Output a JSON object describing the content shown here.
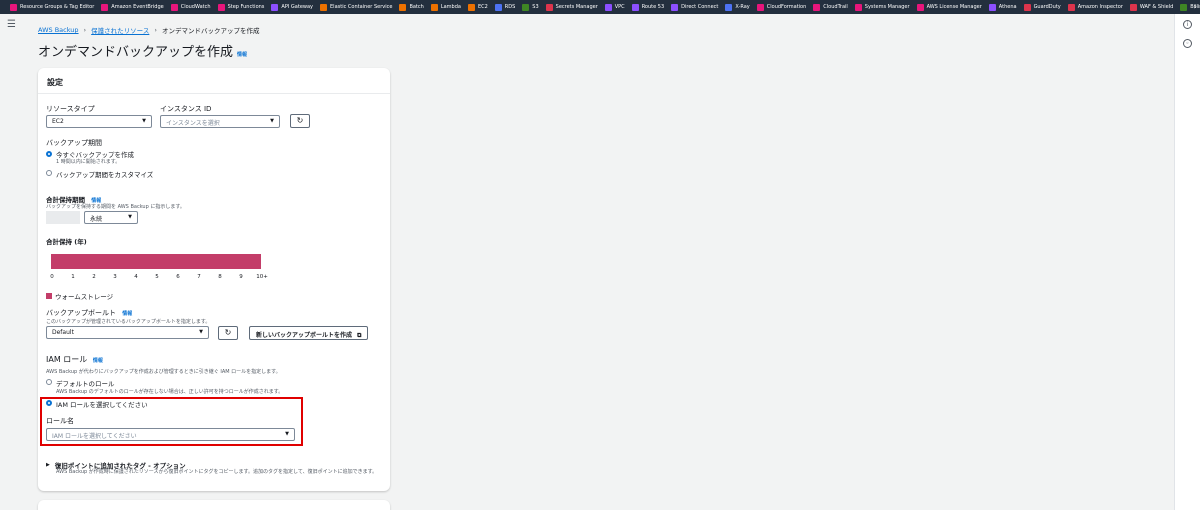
{
  "favorites": [
    {
      "label": "Resource Groups & Tag Editor",
      "color": "#e7157b"
    },
    {
      "label": "Amazon EventBridge",
      "color": "#e7157b"
    },
    {
      "label": "CloudWatch",
      "color": "#e7157b"
    },
    {
      "label": "Step Functions",
      "color": "#e7157b"
    },
    {
      "label": "API Gateway",
      "color": "#8c4fff"
    },
    {
      "label": "Elastic Container Service",
      "color": "#ed7100"
    },
    {
      "label": "Batch",
      "color": "#ed7100"
    },
    {
      "label": "Lambda",
      "color": "#ed7100"
    },
    {
      "label": "EC2",
      "color": "#ed7100"
    },
    {
      "label": "RDS",
      "color": "#4d72f3"
    },
    {
      "label": "S3",
      "color": "#3f8624"
    },
    {
      "label": "Secrets Manager",
      "color": "#dd344c"
    },
    {
      "label": "VPC",
      "color": "#8c4fff"
    },
    {
      "label": "Route 53",
      "color": "#8c4fff"
    },
    {
      "label": "Direct Connect",
      "color": "#8c4fff"
    },
    {
      "label": "X-Ray",
      "color": "#4d72f3"
    },
    {
      "label": "CloudFormation",
      "color": "#e7157b"
    },
    {
      "label": "CloudTrail",
      "color": "#e7157b"
    },
    {
      "label": "Systems Manager",
      "color": "#e7157b"
    },
    {
      "label": "AWS License Manager",
      "color": "#e7157b"
    },
    {
      "label": "Athena",
      "color": "#8c4fff"
    },
    {
      "label": "GuardDuty",
      "color": "#dd344c"
    },
    {
      "label": "Amazon Inspector",
      "color": "#dd344c"
    },
    {
      "label": "WAF & Shield",
      "color": "#dd344c"
    },
    {
      "label": "Billing",
      "color": "#3f8624"
    }
  ],
  "breadcrumb": {
    "item1": "AWS Backup",
    "item2": "保護されたリソース",
    "current": "オンデマンドバックアップを作成"
  },
  "page": {
    "title": "オンデマンドバックアップを作成",
    "info": "情報"
  },
  "settings": {
    "heading": "設定",
    "resource_type": {
      "label": "リソースタイプ",
      "value": "EC2"
    },
    "instance_id": {
      "label": "インスタンス ID",
      "placeholder": "インスタンスを選択"
    },
    "backup_window": {
      "label": "バックアップ期間",
      "opt_now": "今すぐバックアップを作成",
      "opt_now_desc": "1 時間以内に開始されます。",
      "opt_custom": "バックアップ期間をカスタマイズ"
    },
    "retention": {
      "label": "合計保持期間",
      "info": "情報",
      "desc": "バックアップを保持する期間を AWS Backup に指示します。",
      "unit": "永続"
    },
    "retention_chart": {
      "label": "合計保持 (年)",
      "ticks": [
        "0",
        "1",
        "2",
        "3",
        "4",
        "5",
        "6",
        "7",
        "8",
        "9",
        "10+"
      ],
      "bar_color": "#c33d69",
      "legend": "ウォームストレージ",
      "warm_years": 10
    },
    "vault": {
      "label": "バックアップボールト",
      "info": "情報",
      "desc": "このバックアップが管理されているバックアップボールトを指定します。",
      "value": "Default",
      "create_button": "新しいバックアップボールトを作成"
    },
    "iam": {
      "label": "IAM ロール",
      "info": "情報",
      "desc": "AWS Backup が代わりにバックアップを作成および管理するときに引き継ぐ IAM ロールを指定します。",
      "opt_default": "デフォルトのロール",
      "opt_default_desc": "AWS Backup のデフォルトのロールが存在しない場合は、正しい許可を持つロールが作成されます。",
      "opt_choose": "IAM ロールを選択してください",
      "role_name_label": "ロール名",
      "role_placeholder": "IAM ロールを選択してください"
    },
    "tags": {
      "label": "復旧ポイントに追加されたタグ - オプション",
      "desc": "AWS Backup が作成時に保護されたリソースから復旧ポイントにタグをコピーします。追加のタグを指定して、復旧ポイントに追加できます。"
    }
  }
}
